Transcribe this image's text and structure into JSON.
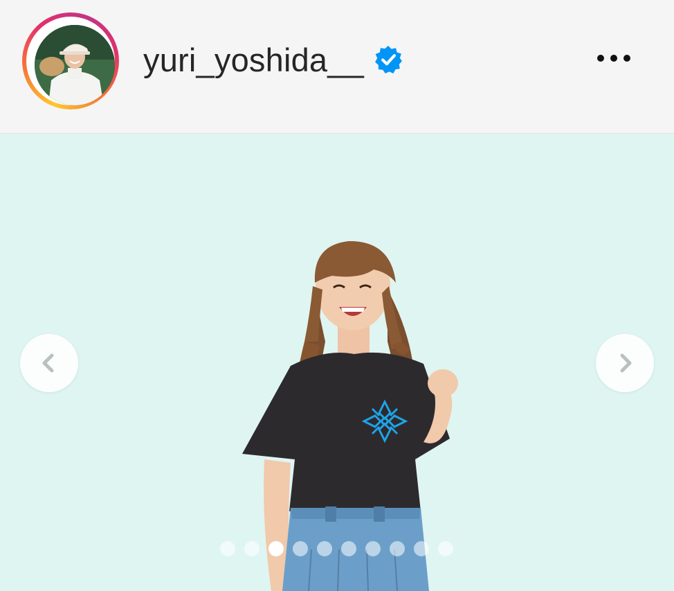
{
  "post": {
    "username": "yuri_yoshida__",
    "verified": true,
    "verified_icon": "verified-badge-icon",
    "more_icon": "more-options-icon",
    "colors": {
      "verified_blue": "#0095f6",
      "carousel_bg": "#dff5f2",
      "shirt": "#2d2a2e",
      "shirt_emblem": "#1da4e8",
      "skirt": "#6b9fc9"
    }
  },
  "carousel": {
    "prev_icon": "chevron-left-icon",
    "next_icon": "chevron-right-icon",
    "slide_count": 10,
    "active_index": 2
  }
}
